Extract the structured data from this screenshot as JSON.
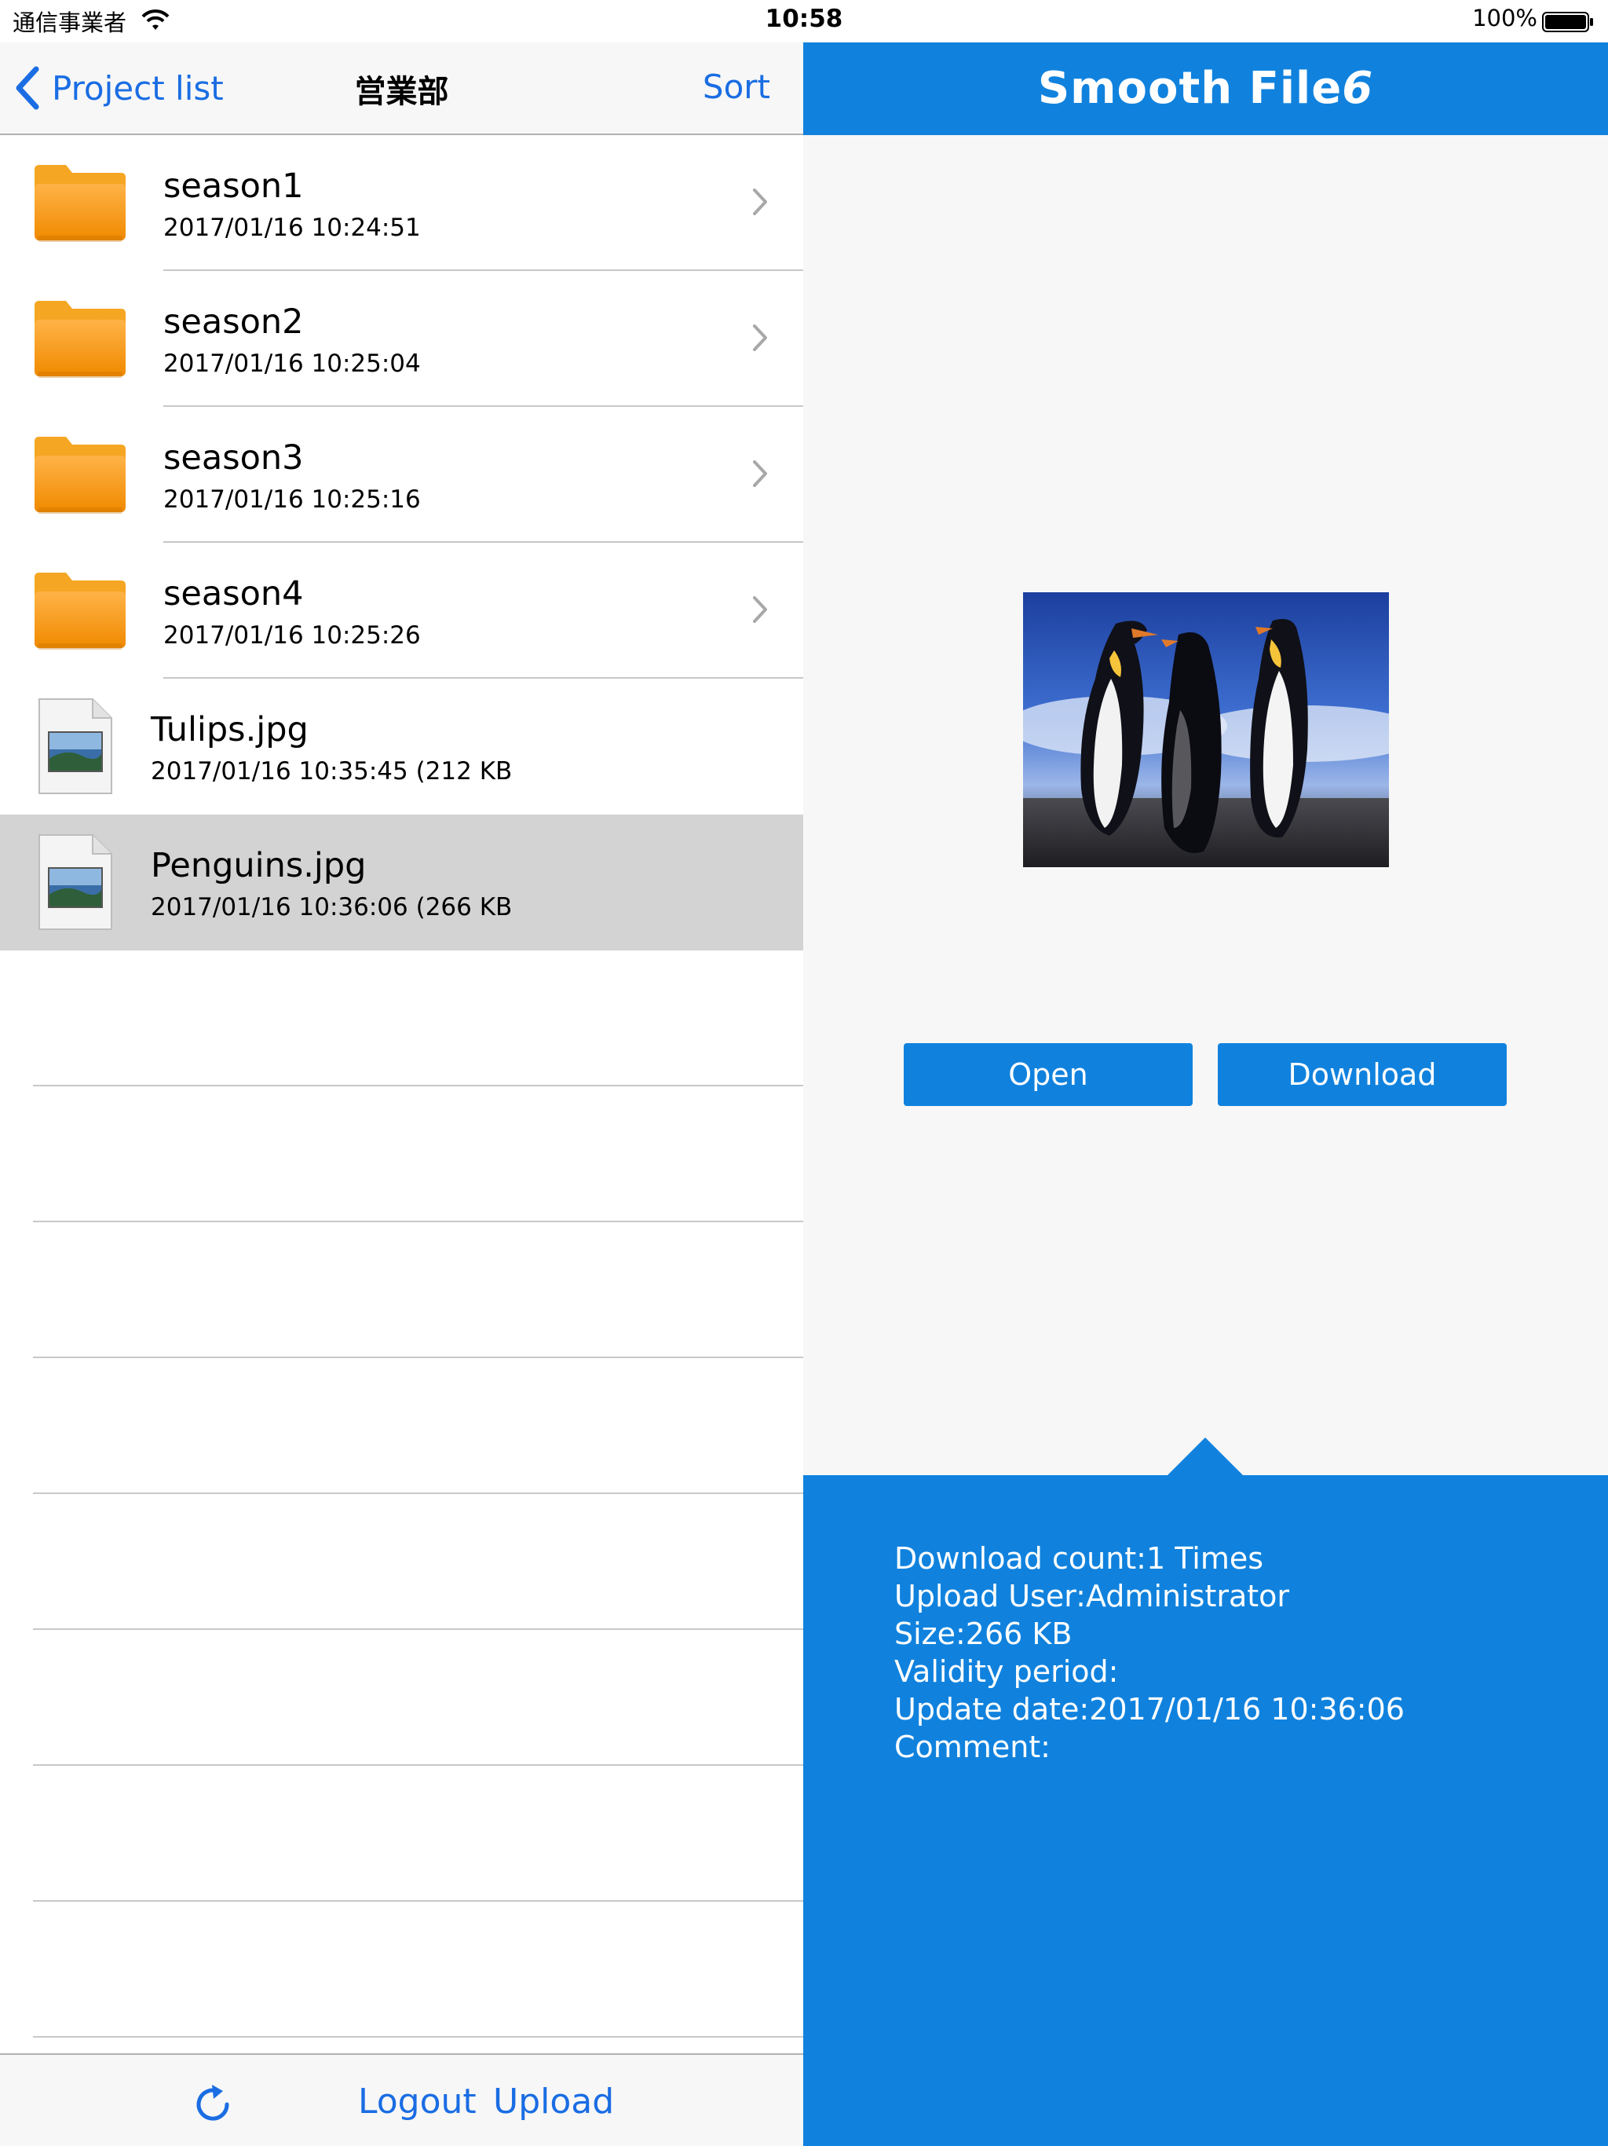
{
  "status_bar": {
    "carrier": "通信事業者",
    "time": "10:58",
    "battery": "100%"
  },
  "nav": {
    "back_label": "Project list",
    "title": "営業部",
    "sort_label": "Sort"
  },
  "items": [
    {
      "name": "season1",
      "date": "2017/01/16 10:24:51",
      "type": "folder"
    },
    {
      "name": "season2",
      "date": "2017/01/16 10:25:04",
      "type": "folder"
    },
    {
      "name": "season3",
      "date": "2017/01/16 10:25:16",
      "type": "folder"
    },
    {
      "name": "season4",
      "date": "2017/01/16 10:25:26",
      "type": "folder"
    },
    {
      "name": "Tulips.jpg",
      "date": "2017/01/16 10:35:45 (212 KB",
      "type": "file"
    },
    {
      "name": "Penguins.jpg",
      "date": "2017/01/16 10:36:06 (266 KB",
      "type": "file",
      "selected": true
    }
  ],
  "toolbar": {
    "refresh_icon": "refresh-icon",
    "logout_label": "Logout",
    "upload_label": "Upload"
  },
  "detail": {
    "brand_name": "Smooth File",
    "brand_version": "6",
    "open_label": "Open",
    "download_label": "Download",
    "info": {
      "download_count": "Download count:1 Times",
      "upload_user": "Upload User:Administrator",
      "size": "Size:266 KB",
      "validity": "Validity period:",
      "update_date": "Update date:2017/01/16 10:36:06",
      "comment": "Comment:"
    }
  },
  "colors": {
    "accent": "#1082de",
    "link": "#1a6de3",
    "selected_row": "#d3d3d3"
  }
}
